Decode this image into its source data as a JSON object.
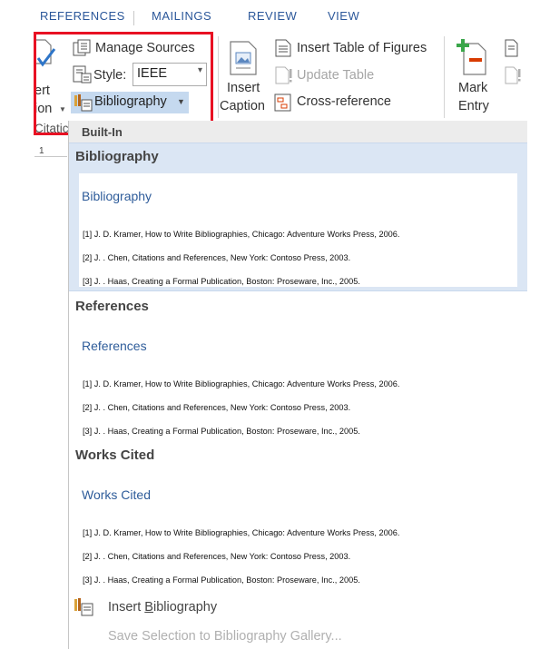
{
  "tabs": [
    "REFERENCES",
    "MAILINGS",
    "REVIEW",
    "VIEW"
  ],
  "ribbon": {
    "insert_citation_1": "ert",
    "insert_citation_2": "ion",
    "citations_group": "Citatic",
    "manage_sources": "Manage Sources",
    "style_label": "Style:",
    "style_value": "IEEE",
    "bibliography": "Bibliography",
    "insert_caption_1": "Insert",
    "insert_caption_2": "Caption",
    "insert_table_of_figures": "Insert Table of Figures",
    "update_table": "Update Table",
    "cross_reference": "Cross-reference",
    "mark_entry_1": "Mark",
    "mark_entry_2": "Entry"
  },
  "ruler": {
    "number": "1"
  },
  "menu": {
    "section_header": "Built-In",
    "items": [
      {
        "title": "Bibliography",
        "heading": "Bibliography",
        "entries": [
          "[1] J. D. Kramer, How to Write Bibliographies, Chicago: Adventure Works Press, 2006.",
          "[2] J. . Chen, Citations and References, New York: Contoso Press, 2003.",
          "[3] J. . Haas, Creating a Formal Publication, Boston: Proseware, Inc., 2005."
        ]
      },
      {
        "title": "References",
        "heading": "References",
        "entries": [
          "[1] J. D. Kramer, How to Write Bibliographies, Chicago: Adventure Works Press, 2006.",
          "[2] J. . Chen, Citations and References, New York: Contoso Press, 2003.",
          "[3] J. . Haas, Creating a Formal Publication, Boston: Proseware, Inc., 2005."
        ]
      },
      {
        "title": "Works Cited",
        "heading": "Works Cited",
        "entries": [
          "[1] J. D. Kramer, How to Write Bibliographies, Chicago: Adventure Works Press, 2006.",
          "[2] J. . Chen, Citations and References, New York: Contoso Press, 2003.",
          "[3] J. . Haas, Creating a Formal Publication, Boston: Proseware, Inc., 2005."
        ]
      }
    ],
    "insert_bibliography_prefix": "Insert ",
    "insert_bibliography_underlined": "B",
    "insert_bibliography_rest": "ibliography",
    "save_selection": "Save Selection to Bibliography Gallery..."
  },
  "colors": {
    "accent": "#2b579a",
    "highlight_border": "#e81123",
    "selected_item_bg": "#dbe6f4",
    "heading_blue": "#2e5c9a"
  },
  "icons": [
    "insert-citation-icon",
    "manage-sources-icon",
    "style-icon",
    "bibliography-icon",
    "insert-caption-icon",
    "table-of-figures-icon",
    "update-table-icon",
    "cross-reference-icon",
    "mark-entry-icon",
    "insert-index-icon",
    "insert-bibliography-icon"
  ]
}
